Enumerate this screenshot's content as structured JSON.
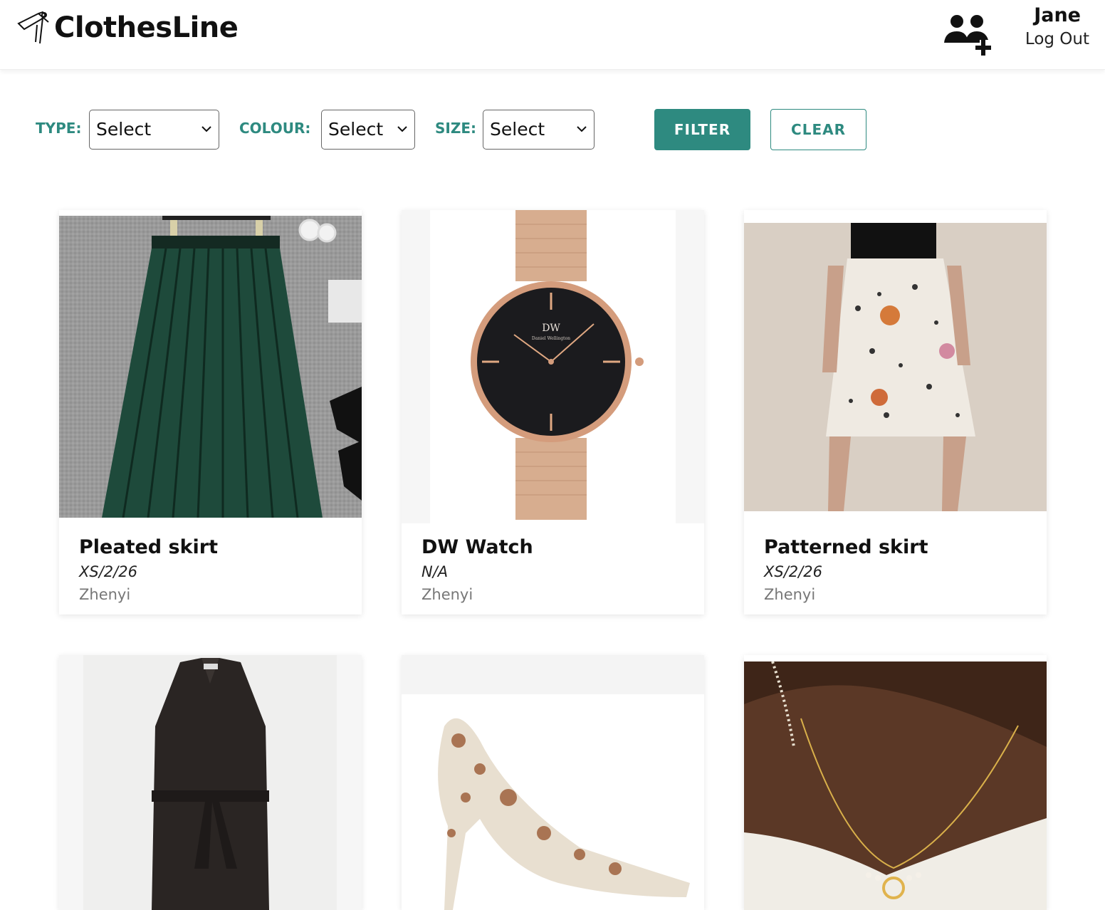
{
  "header": {
    "brand": "ClothesLine",
    "user_name": "Jane",
    "logout_label": "Log Out",
    "add_user_icon": "add-user-icon",
    "logo_icon": "clothes-peg-icon"
  },
  "filters": {
    "type_label": "TYPE:",
    "type_value": "Select",
    "colour_label": "COLOUR:",
    "colour_value": "Select",
    "size_label": "SIZE:",
    "size_value": "Select",
    "filter_label": "FILTER",
    "clear_label": "CLEAR"
  },
  "colors": {
    "accent": "#2e8a80",
    "text": "#111111",
    "muted": "#777777"
  },
  "items": [
    {
      "title": "Pleated skirt",
      "size": "XS/2/26",
      "owner": "Zhenyi"
    },
    {
      "title": "DW Watch",
      "size": "N/A",
      "owner": "Zhenyi",
      "watch_brand": "DW",
      "watch_sub": "Daniel Wellington"
    },
    {
      "title": "Patterned skirt",
      "size": "XS/2/26",
      "owner": "Zhenyi"
    },
    {
      "title": "",
      "size": "",
      "owner": ""
    },
    {
      "title": "",
      "size": "",
      "owner": ""
    },
    {
      "title": "",
      "size": "",
      "owner": ""
    }
  ]
}
